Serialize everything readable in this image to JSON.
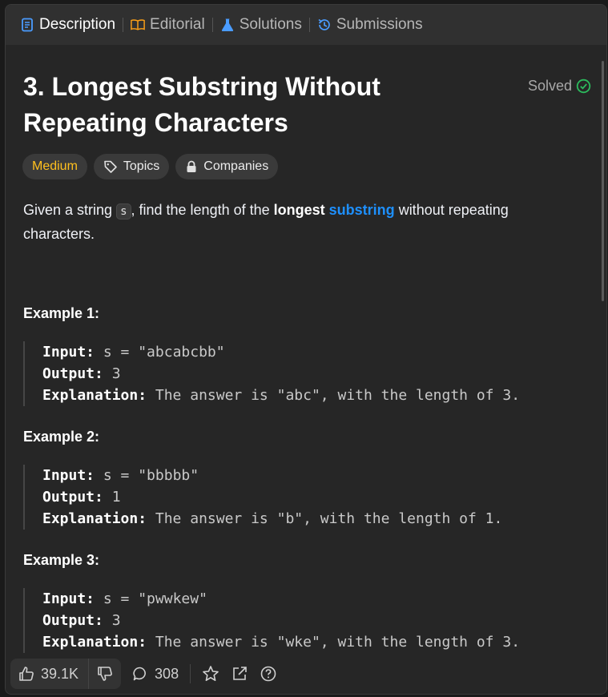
{
  "tabs": [
    {
      "label": "Description",
      "icon": "description-icon",
      "active": true
    },
    {
      "label": "Editorial",
      "icon": "book-icon",
      "active": false
    },
    {
      "label": "Solutions",
      "icon": "flask-icon",
      "active": false
    },
    {
      "label": "Submissions",
      "icon": "history-icon",
      "active": false
    }
  ],
  "problem": {
    "title": "3. Longest Substring Without Repeating Characters",
    "status": "Solved",
    "difficulty": "Medium",
    "topics_label": "Topics",
    "companies_label": "Companies",
    "desc_part1": "Given a string ",
    "desc_code": "s",
    "desc_part2": ", find the length of the ",
    "desc_bold": "longest",
    "desc_space": " ",
    "desc_link": "substring",
    "desc_part3": " without repeating characters."
  },
  "examples": [
    {
      "title": "Example 1:",
      "input_label": "Input:",
      "input": " s = \"abcabcbb\"",
      "output_label": "Output:",
      "output": " 3",
      "explanation_label": "Explanation:",
      "explanation": " The answer is \"abc\", with the length of 3."
    },
    {
      "title": "Example 2:",
      "input_label": "Input:",
      "input": " s = \"bbbbb\"",
      "output_label": "Output:",
      "output": " 1",
      "explanation_label": "Explanation:",
      "explanation": " The answer is \"b\", with the length of 1."
    },
    {
      "title": "Example 3:",
      "input_label": "Input:",
      "input": " s = \"pwwkew\"",
      "output_label": "Output:",
      "output": " 3",
      "explanation_label": "Explanation:",
      "explanation": " The answer is \"wke\", with the length of 3."
    }
  ],
  "footer": {
    "likes": "39.1K",
    "comments": "308"
  },
  "colors": {
    "medium": "#ffc01e",
    "link": "#1e90ff",
    "solved": "#2cbb5d",
    "active_tab_icon": "#4a9cff"
  }
}
